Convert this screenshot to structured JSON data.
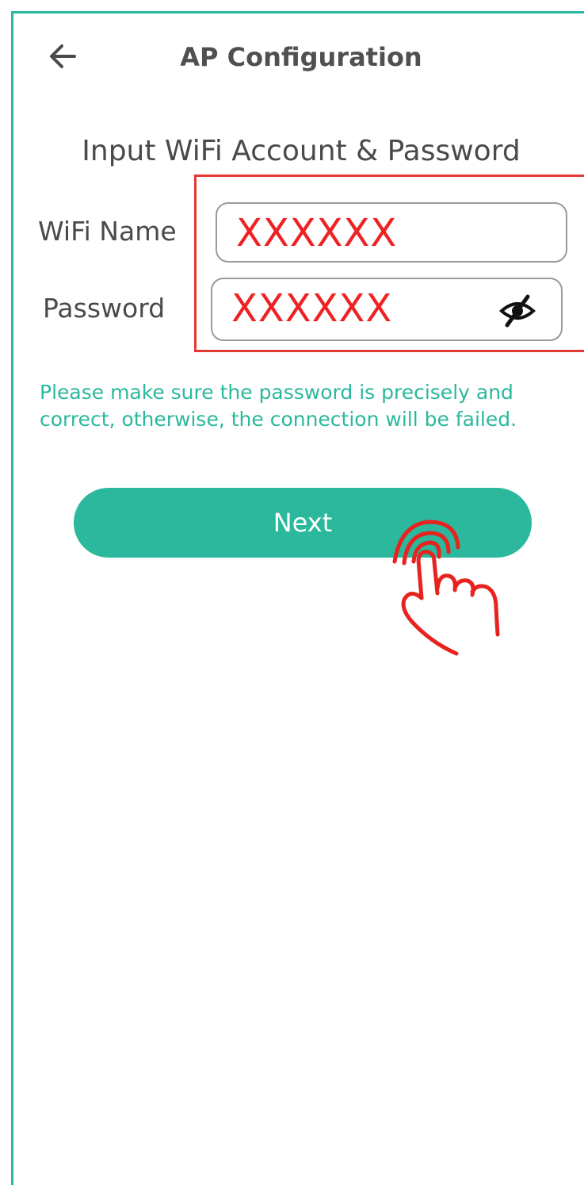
{
  "header": {
    "title": "AP Configuration",
    "back_icon": "arrow-left-icon"
  },
  "form": {
    "subtitle": "Input WiFi Account & Password",
    "wifi_name": {
      "label": "WiFi Name",
      "value": "XXXXXX"
    },
    "password": {
      "label": "Password",
      "value": "XXXXXX",
      "toggle_icon": "eye-slash-icon"
    },
    "hint": "Please make sure the password is precisely and correct, otherwise, the connection will be failed."
  },
  "actions": {
    "next_label": "Next"
  },
  "annotation": {
    "pointer_icon": "tap-hand-icon"
  },
  "colors": {
    "accent": "#2bb89c",
    "annotation_red": "#e53935",
    "placeholder_red": "#ee2222",
    "text_gray": "#4a4a4a"
  }
}
